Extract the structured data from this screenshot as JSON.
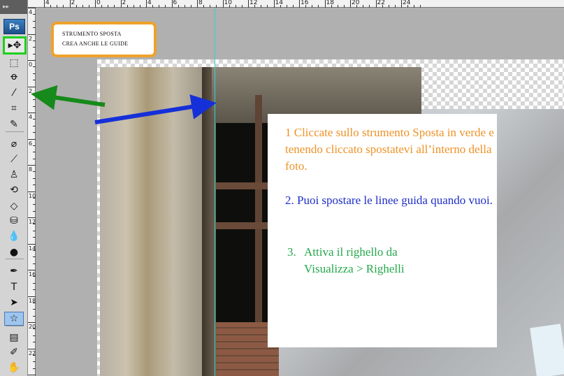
{
  "app": {
    "logo": "Ps",
    "grip": "▸▸"
  },
  "toolbox": {
    "tools": [
      {
        "name": "move-tool",
        "icon": "move-icon",
        "glyph": "▸✥",
        "selected": true
      },
      {
        "name": "marquee-tool",
        "icon": "marquee-icon",
        "glyph": "⬚"
      },
      {
        "name": "lasso-tool",
        "icon": "lasso-icon",
        "glyph": "ꝋ"
      },
      {
        "name": "quick-select-tool",
        "icon": "magic-wand-icon",
        "glyph": "⁄"
      },
      {
        "name": "crop-tool",
        "icon": "crop-icon",
        "glyph": "⌗"
      },
      {
        "name": "eyedropper-tool",
        "icon": "eyedropper-icon",
        "glyph": "✎"
      },
      {
        "name": "healing-tool",
        "icon": "bandage-icon",
        "glyph": "⌀"
      },
      {
        "name": "brush-tool",
        "icon": "brush-icon",
        "glyph": "⟋"
      },
      {
        "name": "stamp-tool",
        "icon": "stamp-icon",
        "glyph": "♙"
      },
      {
        "name": "history-brush-tool",
        "icon": "history-brush-icon",
        "glyph": "⟲"
      },
      {
        "name": "eraser-tool",
        "icon": "eraser-icon",
        "glyph": "◇"
      },
      {
        "name": "bucket-tool",
        "icon": "paint-bucket-icon",
        "glyph": "⛁"
      },
      {
        "name": "blur-tool",
        "icon": "drop-icon",
        "glyph": "💧"
      },
      {
        "name": "dodge-tool",
        "icon": "dodge-icon",
        "glyph": "●"
      },
      {
        "name": "pen-tool",
        "icon": "pen-icon",
        "glyph": "✒"
      },
      {
        "name": "type-tool",
        "icon": "type-icon",
        "glyph": "T"
      },
      {
        "name": "path-select-tool",
        "icon": "arrow-cursor-icon",
        "glyph": "➤"
      },
      {
        "name": "shape-tool",
        "icon": "star-shape-icon",
        "glyph": "☆",
        "pressed": true
      },
      {
        "name": "notes-tool",
        "icon": "notes-icon",
        "glyph": "▤"
      },
      {
        "name": "eyedropper-3d-tool",
        "icon": "eyedropper-icon",
        "glyph": "✐"
      },
      {
        "name": "hand-tool",
        "icon": "hand-icon",
        "glyph": "✋"
      }
    ]
  },
  "ruler_top": {
    "labels": [
      "4",
      "2",
      "0",
      "2",
      "4",
      "6",
      "8",
      "10",
      "12",
      "14",
      "16",
      "18",
      "20",
      "22",
      "24"
    ]
  },
  "ruler_left": {
    "labels": [
      "4",
      "2",
      "0",
      "2",
      "4",
      "6",
      "8",
      "10",
      "12",
      "14",
      "16",
      "18",
      "20",
      "22",
      "2"
    ]
  },
  "callout": {
    "line1": "STRUMENTO SPOSTA",
    "line2": "CREA ANCHE LE GUIDE",
    "border_color": "#f0a22a"
  },
  "instructions": {
    "step1": "1 Cliccate sullo strumento Sposta in verde e tenendo cliccato spostatevi all’interno della foto.",
    "step2": "2. Puoi spostare le linee guida quando vuoi.",
    "step3_num": "3.",
    "step3": "Attiva il righello da Visualizza > Righelli",
    "colors": {
      "step1": "#ee9227",
      "step2": "#1d2ec8",
      "step3": "#23a84a"
    }
  },
  "annotation_colors": {
    "highlight": "#1bd11b",
    "green_arrow": "#168a1a",
    "blue_arrow": "#1530d8",
    "guide": "#31d3d0"
  }
}
